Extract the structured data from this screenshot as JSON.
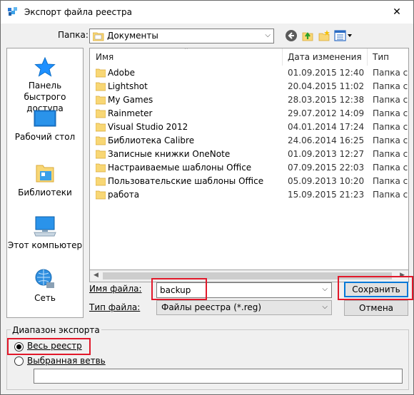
{
  "window": {
    "title": "Экспорт файла реестра",
    "close_glyph": "✕"
  },
  "folder": {
    "label": "Папка:",
    "current": "Документы"
  },
  "places": [
    {
      "label": "Панель быстрого доступа",
      "icon": "star-icon"
    },
    {
      "label": "Рабочий стол",
      "icon": "desktop-icon"
    },
    {
      "label": "Библиотеки",
      "icon": "libraries-icon"
    },
    {
      "label": "Этот компьютер",
      "icon": "computer-icon"
    },
    {
      "label": "Сеть",
      "icon": "network-icon"
    }
  ],
  "filelist": {
    "columns": [
      "Имя",
      "Дата изменения",
      "Тип"
    ],
    "rows": [
      {
        "name": "Adobe",
        "date": "01.09.2015 12:40",
        "type": "Папка с ф"
      },
      {
        "name": "Lightshot",
        "date": "20.04.2015 11:02",
        "type": "Папка с ф"
      },
      {
        "name": "My Games",
        "date": "28.03.2015 12:38",
        "type": "Папка с ф"
      },
      {
        "name": "Rainmeter",
        "date": "29.07.2012 14:09",
        "type": "Папка с ф"
      },
      {
        "name": "Visual Studio 2012",
        "date": "04.01.2014 17:24",
        "type": "Папка с ф"
      },
      {
        "name": "Библиотека Calibre",
        "date": "24.06.2014 16:25",
        "type": "Папка с ф"
      },
      {
        "name": "Записные книжки OneNote",
        "date": "01.09.2013 12:27",
        "type": "Папка с ф"
      },
      {
        "name": "Настраиваемые шаблоны Office",
        "date": "07.09.2015 22:03",
        "type": "Папка с ф"
      },
      {
        "name": "Пользовательские шаблоны Office",
        "date": "05.09.2013 10:20",
        "type": "Папка с ф"
      },
      {
        "name": "работа",
        "date": "15.09.2015 21:23",
        "type": "Папка с ф"
      }
    ]
  },
  "filename": {
    "label": "Имя файла:",
    "value": "backup"
  },
  "filetype": {
    "label": "Тип файла:",
    "value": "Файлы реестра (*.reg)"
  },
  "buttons": {
    "save": "Сохранить",
    "cancel": "Отмена"
  },
  "export_range": {
    "title": "Диапазон экспорта",
    "all": "Весь реестр",
    "selected": "Выбранная ветвь",
    "selected_path": ""
  },
  "colors": {
    "highlight": "#e2182a",
    "folder": "#f8d775",
    "accent": "#0078d7"
  }
}
